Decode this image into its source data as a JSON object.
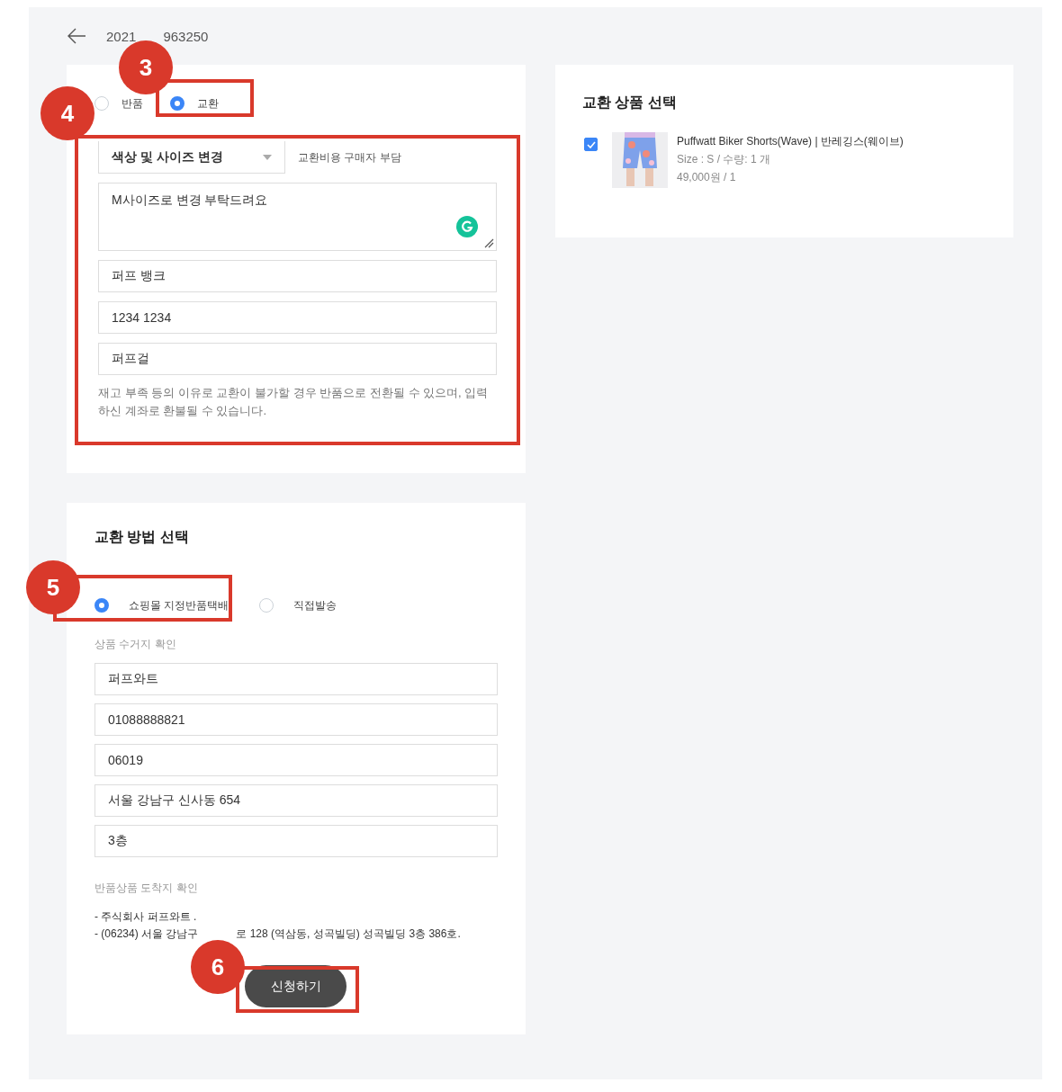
{
  "header": {
    "order_number_parts": [
      "2021",
      "963250"
    ]
  },
  "request_type": {
    "marker": "3",
    "options": [
      {
        "label": "반품",
        "selected": false,
        "highlighted": false
      },
      {
        "label": "교환",
        "selected": true,
        "highlighted": true
      }
    ]
  },
  "exchange_details": {
    "marker": "4",
    "highlighted": true,
    "reason": "색상 및 사이즈 변경",
    "fee_note": "교환비용 구매자 부담",
    "message": "M사이즈로 변경 부탁드려요",
    "bank": "퍼프 뱅크",
    "account": "1234 1234",
    "holder": "퍼프걸",
    "notice": "재고 부족 등의 이유로 교환이 불가할 경우 반품으로 전환될 수 있으며, 입력하신 계좌로 환불될 수 있습니다."
  },
  "method": {
    "title": "교환 방법 선택",
    "marker": "5",
    "options": [
      {
        "label": "쇼핑몰 지정반품택배",
        "selected": true,
        "highlighted": true
      },
      {
        "label": "직접발송",
        "selected": false,
        "highlighted": false
      }
    ]
  },
  "pickup": {
    "label": "상품 수거지 확인",
    "fields": [
      "퍼프와트",
      "01088888821",
      "06019",
      "서울 강남구 신사동 654",
      "3층"
    ]
  },
  "destination": {
    "label": "반품상품 도착지 확인",
    "lines": [
      [
        "- 주식회사 퍼프와트 ."
      ],
      [
        "- (06234) 서울 강남구",
        "로 128 (역삼동, 성곡빌딩) 성곡빌딩 3층 386호."
      ]
    ]
  },
  "submit": {
    "label": "신청하기",
    "marker": "6",
    "highlighted": true
  },
  "product_panel": {
    "title": "교환 상품 선택",
    "items": [
      {
        "checked": true,
        "name": "Puffwatt Biker Shorts(Wave) | 반레깅스(웨이브)",
        "detail": "Size : S / 수량: 1 개",
        "price": "49,000원 / 1"
      }
    ]
  }
}
